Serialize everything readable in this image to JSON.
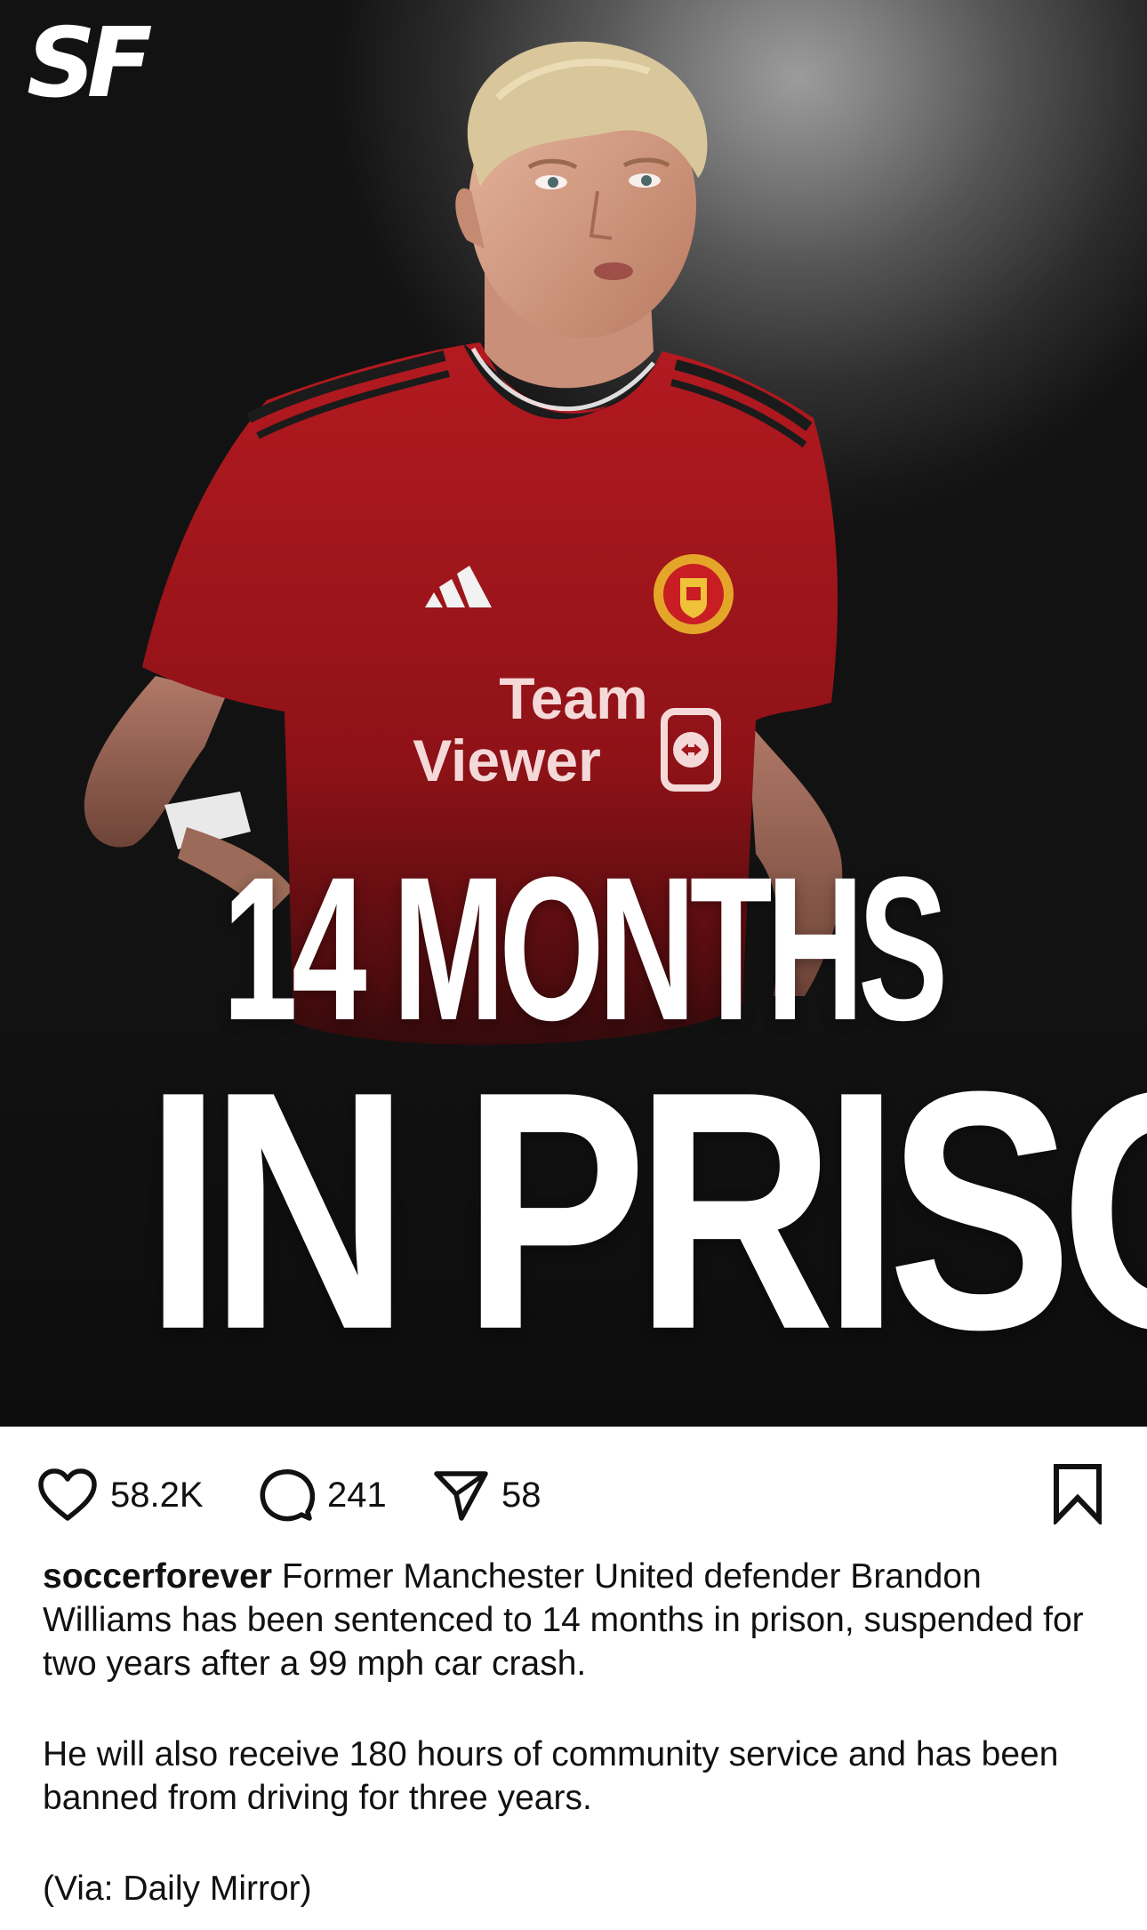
{
  "image": {
    "brand_logo": "SF",
    "jersey_sponsor_line1": "Team",
    "jersey_sponsor_line2": "Viewer",
    "headline_line1": "14 MONTHS",
    "headline_line2": "IN PRISON"
  },
  "actions": {
    "likes": "58.2K",
    "comments": "241",
    "shares": "58",
    "like_icon": "heart-icon",
    "comment_icon": "comment-bubble-icon",
    "share_icon": "paper-plane-icon",
    "save_icon": "bookmark-icon"
  },
  "caption": {
    "username": "soccerforever",
    "paragraph1": "Former Manchester United defender Brandon Williams has been sentenced to 14 months in prison, suspended for two years after a 99 mph car crash.",
    "paragraph2": "He will also receive 180 hours of community service and has been banned from driving for three years.",
    "paragraph3": "(Via: Daily Mirror)"
  },
  "colors": {
    "jersey_red": "#a3161b",
    "background_dark": "#1d1d1d",
    "text": "#111111"
  }
}
